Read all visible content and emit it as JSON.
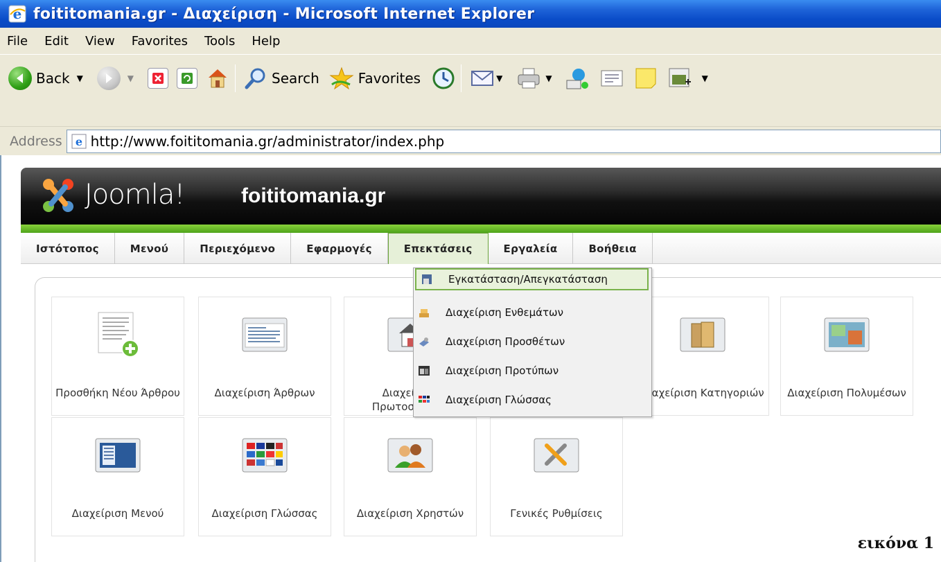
{
  "window": {
    "title": "foititomania.gr - Διαχείριση - Microsoft Internet Explorer"
  },
  "menubar": {
    "items": [
      "File",
      "Edit",
      "View",
      "Favorites",
      "Tools",
      "Help"
    ]
  },
  "toolbar": {
    "back_label": "Back",
    "search_label": "Search",
    "favorites_label": "Favorites",
    "icons": [
      "back-icon",
      "forward-icon",
      "stop-icon",
      "refresh-icon",
      "home-icon",
      "search-icon",
      "favorites-star-icon",
      "history-icon",
      "mail-icon",
      "print-icon",
      "messenger-icon",
      "edit-icon",
      "notes-icon",
      "media-icon"
    ]
  },
  "address": {
    "label": "Address",
    "url": "http://www.foititomania.gr/administrator/index.php"
  },
  "joomla": {
    "brand": "Joomla!",
    "site": "foititomania.gr"
  },
  "nav": {
    "items": [
      "Ιστότοπος",
      "Μενού",
      "Περιεχόμενο",
      "Εφαρμογές",
      "Επεκτάσεις",
      "Εργαλεία",
      "Βοήθεια"
    ],
    "active": "Επεκτάσεις"
  },
  "tiles": [
    {
      "label": "Προσθήκη Νέου Άρθρου",
      "icon": "add-article-icon"
    },
    {
      "label": "Διαχείριση Άρθρων",
      "icon": "article-manager-icon"
    },
    {
      "label": "Διαχείριση Πρωτοσέλιδου",
      "icon": "frontpage-manager-icon"
    },
    {
      "label": "Διαχείριση Κατηγοριών",
      "icon": "category-manager-icon"
    },
    {
      "label": "Διαχείριση Πολυμέσων",
      "icon": "media-manager-icon"
    },
    {
      "label": "Διαχείριση Μενού",
      "icon": "menu-manager-icon"
    },
    {
      "label": "Διαχείριση Γλώσσας",
      "icon": "language-manager-icon"
    },
    {
      "label": "Διαχείριση Χρηστών",
      "icon": "user-manager-icon"
    },
    {
      "label": "Γενικές Ρυθμίσεις",
      "icon": "global-config-icon"
    }
  ],
  "dropdown": {
    "items": [
      {
        "label": "Εγκατάσταση/Απεγκατάσταση",
        "icon": "install-icon"
      },
      {
        "label": "Διαχείριση Ενθεμάτων",
        "icon": "module-icon"
      },
      {
        "label": "Διαχείριση Προσθέτων",
        "icon": "plugin-icon"
      },
      {
        "label": "Διαχείριση Προτύπων",
        "icon": "template-icon"
      },
      {
        "label": "Διαχείριση Γλώσσας",
        "icon": "language-icon"
      }
    ],
    "highlighted": "Εγκατάσταση/Απεγκατάσταση"
  },
  "caption": "εικόνα 1",
  "colors": {
    "titlebar": "#0a4cc8",
    "accent_green": "#6aa33a",
    "joomla_header": "#111111"
  }
}
